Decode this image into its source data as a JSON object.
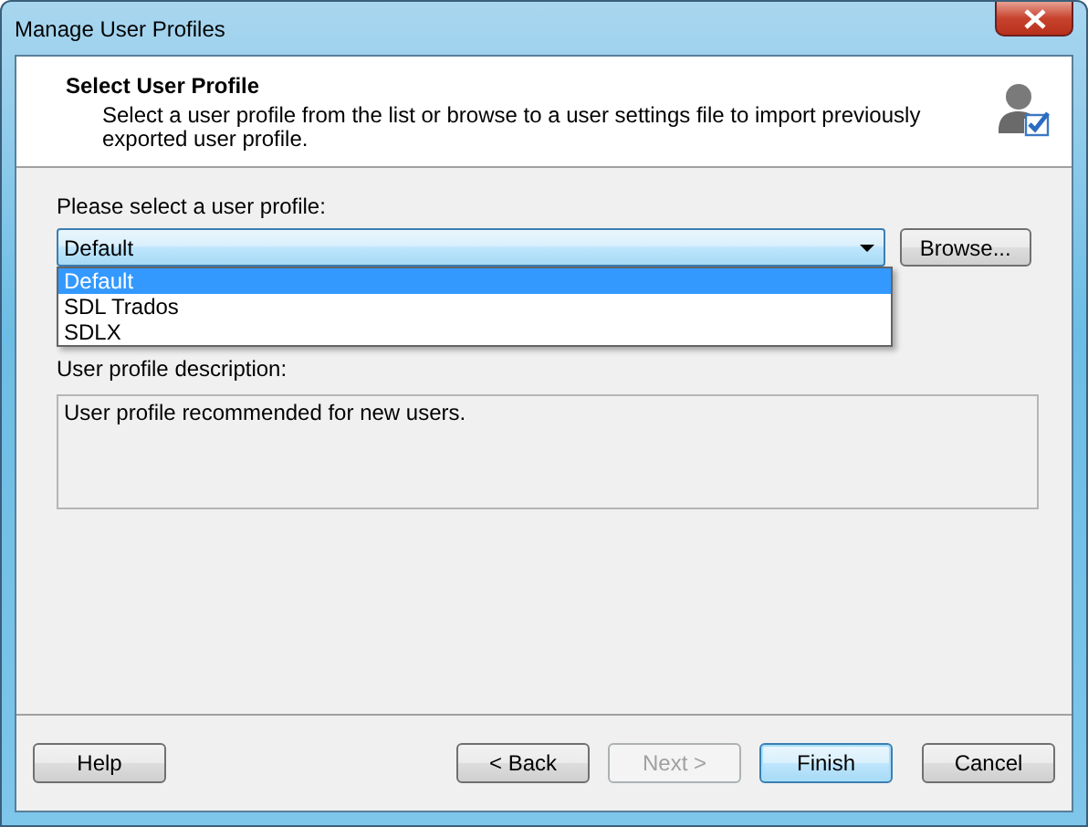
{
  "window": {
    "title": "Manage User Profiles"
  },
  "header": {
    "title": "Select User Profile",
    "description": "Select a user profile from the list or browse to a user settings file to import previously exported user profile."
  },
  "profile_select": {
    "label": "Please select a user profile:",
    "value": "Default",
    "expanded": true,
    "options": [
      {
        "label": "Default",
        "selected": true
      },
      {
        "label": "SDL Trados",
        "selected": false
      },
      {
        "label": "SDLX",
        "selected": false
      }
    ]
  },
  "browse_button": {
    "label": "Browse..."
  },
  "description": {
    "label": "User profile description:",
    "value": "User profile recommended for new users."
  },
  "buttons": [
    {
      "label": "Help",
      "kind": "help",
      "disabled": false,
      "default": false
    },
    {
      "label": "< Back",
      "kind": "nav",
      "disabled": false,
      "default": false
    },
    {
      "label": "Next >",
      "kind": "nav",
      "disabled": true,
      "default": false
    },
    {
      "label": "Finish",
      "kind": "nav",
      "disabled": false,
      "default": true
    },
    {
      "label": "Cancel",
      "kind": "cancel",
      "disabled": false,
      "default": false
    }
  ]
}
